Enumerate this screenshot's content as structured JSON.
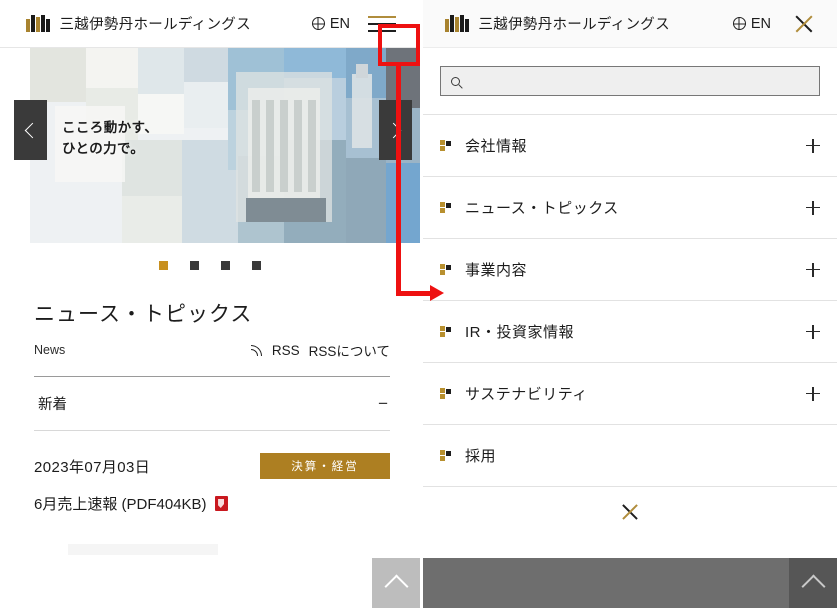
{
  "site": {
    "brand_name": "三越伊勢丹ホールディングス",
    "lang_label": "EN",
    "logo_icon": "mitsukoshi-isetan-bars-logo",
    "globe_icon": "globe-icon",
    "hamburger_icon": "hamburger-menu-icon"
  },
  "hero": {
    "headline_line1": "こころ動かす、",
    "headline_line2": "ひとの力で。",
    "prev_icon": "chevron-left-icon",
    "next_icon": "chevron-right-icon",
    "slide_count": 4,
    "active_slide": 1,
    "active_dot_color": "#c8901f",
    "inactive_dot_color": "#3a3a3a"
  },
  "news": {
    "title": "ニュース・トピックス",
    "subtitle_en": "News",
    "rss_label": "RSS",
    "rss_about_label": "RSSについて",
    "rss_icon": "rss-icon",
    "accordion_label": "新着",
    "accordion_sign": "−",
    "items": [
      {
        "date": "2023年07月03日",
        "tag": "決算・経営",
        "tag_color": "#ad7f22",
        "title": "6月売上速報 (PDF404KB)",
        "file_icon": "pdf-icon"
      }
    ]
  },
  "menu_panel": {
    "brand_name": "三越伊勢丹ホールディングス",
    "lang_label": "EN",
    "close_icon": "close-x-icon",
    "search": {
      "value": "",
      "placeholder": "",
      "icon": "search-magnifier-icon"
    },
    "items": [
      {
        "label": "会社情報",
        "expand": "+",
        "has_expand": true
      },
      {
        "label": "ニュース・トピックス",
        "expand": "+",
        "has_expand": true
      },
      {
        "label": "事業内容",
        "expand": "+",
        "has_expand": true
      },
      {
        "label": "IR・投資家情報",
        "expand": "+",
        "has_expand": true
      },
      {
        "label": "サステナビリティ",
        "expand": "+",
        "has_expand": true
      },
      {
        "label": "採用",
        "expand": "",
        "has_expand": false
      }
    ],
    "bullet_icon": "square-bullet-icon",
    "bottom_close_icon": "close-x-icon"
  },
  "overlays": {
    "scroll_top_icon": "chevron-up-icon",
    "scroll_top_left_bg": "#bdbdbd",
    "scroll_top_right_bg": "#565656",
    "gray_band_color": "#6e6e6e"
  },
  "annotation": {
    "highlight_color": "#ee1111",
    "highlight_target": "hamburger-menu-icon",
    "arrow_target": "事業内容"
  }
}
